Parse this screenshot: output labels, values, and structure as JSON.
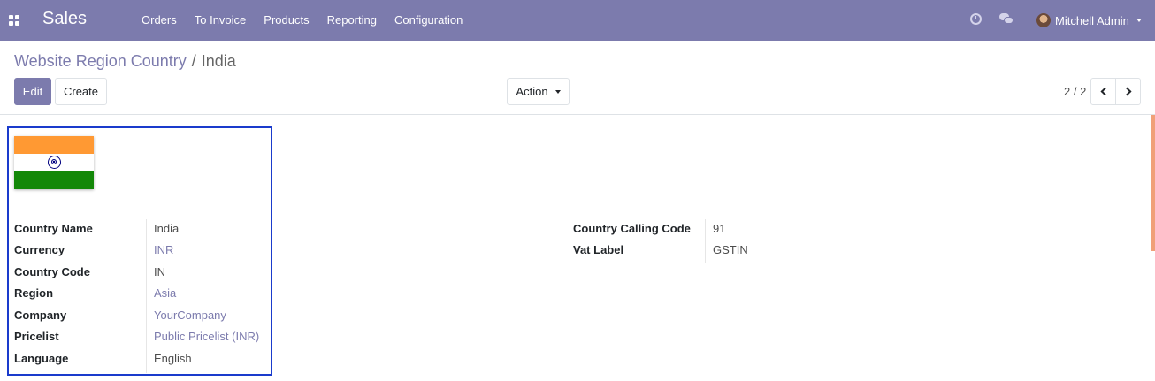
{
  "navbar": {
    "app_name": "Sales",
    "menu": [
      "Orders",
      "To Invoice",
      "Products",
      "Reporting",
      "Configuration"
    ],
    "user_name": "Mitchell Admin",
    "icons": [
      "apps-icon",
      "clock-icon",
      "chat-icon",
      "avatar",
      "chevron-down-icon"
    ]
  },
  "breadcrumb": {
    "parent": "Website Region Country",
    "separator": "/",
    "current": "India"
  },
  "buttons": {
    "edit": "Edit",
    "create": "Create",
    "action": "Action"
  },
  "pager": {
    "value": "2 / 2"
  },
  "form": {
    "left_fields": [
      {
        "label": "Country Name",
        "value": "India",
        "link": false
      },
      {
        "label": "Currency",
        "value": "INR",
        "link": true
      },
      {
        "label": "Country Code",
        "value": "IN",
        "link": false
      },
      {
        "label": "Region",
        "value": "Asia",
        "link": true
      },
      {
        "label": "Company",
        "value": "YourCompany",
        "link": true
      },
      {
        "label": "Pricelist",
        "value": "Public Pricelist (INR)",
        "link": true
      },
      {
        "label": "Language",
        "value": "English",
        "link": false
      }
    ],
    "right_fields": [
      {
        "label": "Country Calling Code",
        "value": "91",
        "link": false
      },
      {
        "label": "Vat Label",
        "value": "GSTIN",
        "link": false
      }
    ]
  },
  "colors": {
    "brand": "#7c7bad",
    "highlight_border": "#1a3bcc",
    "link": "#7c7bad"
  }
}
